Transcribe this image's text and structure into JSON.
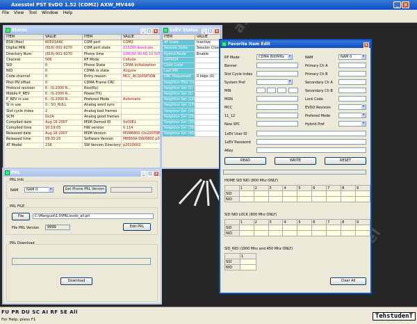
{
  "app": {
    "title": "Axesstel PST EvDO 1.52 (COM2) AXW_MV440",
    "menu": [
      "File",
      "View",
      "Tool",
      "Window",
      "Help"
    ]
  },
  "brand": {
    "text": "axess·tel"
  },
  "status_win": {
    "title": "Status",
    "headers": [
      "ITEM",
      "VALUE",
      "ITEM",
      "VALUE"
    ],
    "rows": [
      [
        "ESN (Hex)",
        "60591AAC",
        "COM port",
        "COM2"
      ],
      [
        "Digital MIN",
        "(816) 001-9270",
        "COM port state",
        "115200 baudrate"
      ],
      [
        "Directory Num",
        "(816) 001-9270",
        "Phone time",
        "1/06/00 00:00:10.505"
      ],
      [
        "Channel",
        "506",
        "RF Mode",
        "Cellular"
      ],
      [
        "SID",
        "0",
        "Phone State",
        "CDMA Initialization"
      ],
      [
        "NID",
        "0",
        "CDMA rx state",
        "Acquire"
      ],
      [
        "Code channel",
        "0",
        "Entry reason",
        "MCC_ACQUISITION"
      ],
      [
        "Pilot PN offset",
        "0",
        "CDMA Frame CRC",
        ""
      ],
      [
        "Protocol revision",
        "6 : IS-2000 R...",
        "Rssi(Rx)",
        ""
      ],
      [
        "Mobile P_REV",
        "6 : IS-2000 R...",
        "Power(TX)",
        ""
      ],
      [
        "P_REV in use",
        "6 : IS-2000 R...",
        "Prefered Mode",
        "Automatic"
      ],
      [
        "SI in use",
        "0 : SO_NULL",
        "Analog word sync",
        ""
      ],
      [
        "Slot cycle index",
        "2",
        "Analog bad frames",
        ""
      ],
      [
        "SCM",
        "0x2A",
        "Analog good frames",
        ""
      ],
      [
        "Compiled date",
        "Aug 16 2007",
        "MSM Demod ID",
        "0x00E1"
      ],
      [
        "Compiled time",
        "10:19:05",
        "HW version",
        "0.114"
      ],
      [
        "Released date",
        "Aug 16 2007",
        "MSM Version",
        "MSM6800 (0x20070E1)"
      ],
      [
        "Released time",
        "09:30:25",
        "Software Version",
        "M6800A-SW/6800 p0070002"
      ],
      [
        "AT Model",
        "238",
        "SW Version Directory",
        "p2010002"
      ]
    ]
  },
  "evdo_win": {
    "title": "1xEV Status",
    "headers": [
      "ITEM",
      "VALUE"
    ],
    "rows": [
      [
        "AT State",
        "Inactive"
      ],
      [
        "Session State",
        "Session Close"
      ],
      [
        "Hybrid Mode",
        "Enable"
      ],
      [
        "UATI024",
        ""
      ],
      [
        "Color Code",
        ""
      ],
      [
        "Last RRI",
        ""
      ],
      [
        "DRC Requested",
        "0 kbps (0)"
      ],
      [
        "Neighbor Pilot Co...",
        ""
      ],
      [
        "Neighbor Set (1)",
        ""
      ],
      [
        "Neighbor Set (5)",
        ""
      ],
      [
        "Neighbor Set (10)",
        ""
      ],
      [
        "Neighbor Set (15)",
        ""
      ],
      [
        "Neighbor Set (20)",
        ""
      ],
      [
        "Neighbor Set (25)",
        ""
      ],
      [
        "Neighbor Set (30)",
        ""
      ],
      [
        "Neighbor Set (35)",
        ""
      ],
      [
        "Neighbor Set (40)",
        ""
      ]
    ]
  },
  "prl_win": {
    "title": "PRL",
    "info_group": "PRL Info",
    "nam_label": "NAM",
    "nam_value": "NAM 0",
    "get_btn": "Get Phone PRL Version",
    "file_group": "PRL FILE",
    "file_btn": "File",
    "file_path": "C:\\Manguol\\1.0\\PRL\\evdo_all.prl",
    "ver_label": "File PRL Version",
    "ver_value": "9999",
    "edit_btn": "Edit PRL",
    "dl_group": "PRL Download",
    "dl_btn": "Download"
  },
  "fav_win": {
    "title": "Favorite Item Edit",
    "left_labels": [
      "RF Mode",
      "Banner",
      "Slot Cycle Index",
      "System Pref",
      "MIN",
      "MDN",
      "MCC",
      "11_12",
      "New SPC"
    ],
    "rf_mode_value": "CDMA 800MHz",
    "right_labels": [
      "NAM",
      "Primary Ch A",
      "Primary Ch B",
      "Secondary Ch A",
      "Secondary Ch B",
      "Lock Code",
      "EVDO Revision",
      "Prefered Mode",
      "Hybrid Pref"
    ],
    "nam_value": "NAM 0",
    "ev_labels": [
      "1xEV User ID",
      "1xEV Password",
      "AKey"
    ],
    "buttons": {
      "read": "READ",
      "write": "WRITE",
      "reset": "RESET",
      "clear": "Clear All"
    },
    "tables": [
      {
        "title": "HOME SID NID  (800 Mhz ONLY)",
        "cols": [
          "1",
          "2",
          "3",
          "4",
          "5",
          "6",
          "7",
          "8",
          "9"
        ],
        "rows": [
          "SID",
          "NID"
        ]
      },
      {
        "title": "SID NID LOCK  (800 Mhz ONLY)",
        "cols": [
          "1",
          "2",
          "3",
          "4",
          "5",
          "6",
          "7",
          "8",
          "9"
        ],
        "rows": [
          "SID",
          "NID"
        ]
      },
      {
        "title": "SID_NID  (1900 Mhz and 450 Mhz ONLY)",
        "cols": [
          "1"
        ],
        "rows": [
          "SID",
          "NID"
        ]
      }
    ]
  },
  "status_bar": {
    "tabs": "FU PR DU SC AI RF SE All",
    "hint": "For Help, press F1"
  },
  "watermark": "TehstudenT"
}
